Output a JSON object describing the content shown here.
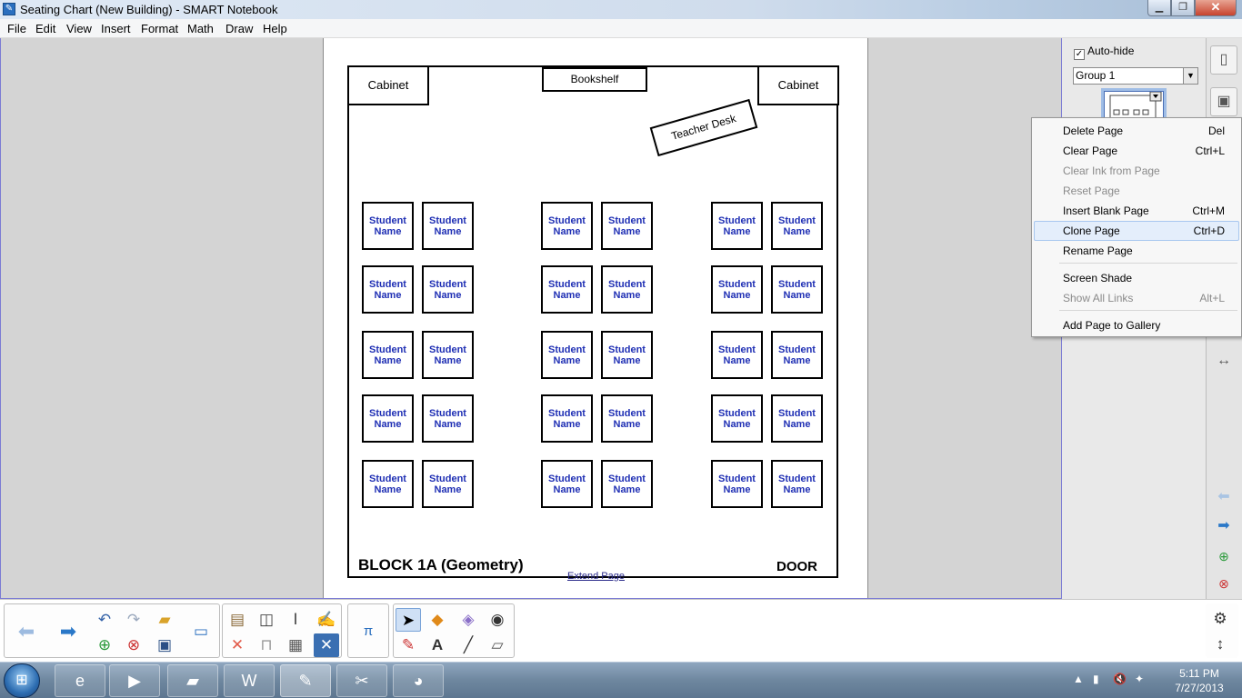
{
  "window": {
    "title": "Seating Chart (New Building) - SMART Notebook",
    "app_icon": "notebook-icon",
    "minimize": "▁",
    "maximize": "❐",
    "close": "✕"
  },
  "menubar": {
    "items": [
      "File",
      "Edit",
      "View",
      "Insert",
      "Format",
      "Math",
      "Draw",
      "Help"
    ]
  },
  "page": {
    "cabinet_left": "Cabinet",
    "bookshelf": "Bookshelf",
    "cabinet_right": "Cabinet",
    "teacher_desk": "Teacher Desk",
    "desk_line1": "Student",
    "desk_line2": "Name",
    "block_label": "BLOCK 1A (Geometry)",
    "door_label": "DOOR",
    "extend_page": "Extend Page"
  },
  "sidepanel": {
    "autohide_label": "Auto-hide",
    "autohide_checked": true,
    "group_select": "Group 1"
  },
  "context_menu": {
    "items": [
      {
        "label": "Delete Page",
        "shortcut": "Del",
        "enabled": true
      },
      {
        "label": "Clear Page",
        "shortcut": "Ctrl+L",
        "enabled": true
      },
      {
        "label": "Clear Ink from Page",
        "shortcut": "",
        "enabled": false
      },
      {
        "label": "Reset Page",
        "shortcut": "",
        "enabled": false
      },
      {
        "label": "Insert Blank Page",
        "shortcut": "Ctrl+M",
        "enabled": true
      },
      {
        "label": "Clone Page",
        "shortcut": "Ctrl+D",
        "enabled": true,
        "highlighted": true
      },
      {
        "label": "Rename Page",
        "shortcut": "",
        "enabled": true
      },
      {
        "label": "Screen Shade",
        "shortcut": "",
        "enabled": true
      },
      {
        "label": "Show All Links",
        "shortcut": "Alt+L",
        "enabled": false
      },
      {
        "label": "Add Page to Gallery",
        "shortcut": "",
        "enabled": true
      }
    ]
  },
  "toolbar": {
    "icons": [
      "back-arrow-icon",
      "forward-arrow-icon",
      "undo-icon",
      "redo-icon",
      "open-folder-icon",
      "add-page-icon",
      "delete-page-icon",
      "save-icon",
      "display-icon",
      "paste-icon",
      "screen-capture-icon",
      "delete-icon",
      "screen-shade-icon",
      "table-icon",
      "text-tool-icon",
      "close-box-icon",
      "pi-math-icon",
      "select-pointer-icon",
      "shapes-icon",
      "eraser-icon",
      "fill-icon",
      "pens-icon",
      "text-icon",
      "line-icon",
      "eraser2-icon",
      "settings-icon",
      "move-toolbar-icon"
    ]
  },
  "taskbar": {
    "apps": [
      "internet-explorer-icon",
      "media-player-icon",
      "file-explorer-icon",
      "word-icon",
      "smart-notebook-icon",
      "snipping-tool-icon",
      "paint-icon"
    ],
    "time": "5:11 PM",
    "date": "7/27/2013"
  },
  "colors": {
    "accent": "#7c7cd4",
    "desk_text": "#1f2fb4",
    "menu_highlight": "#e4eefb"
  }
}
